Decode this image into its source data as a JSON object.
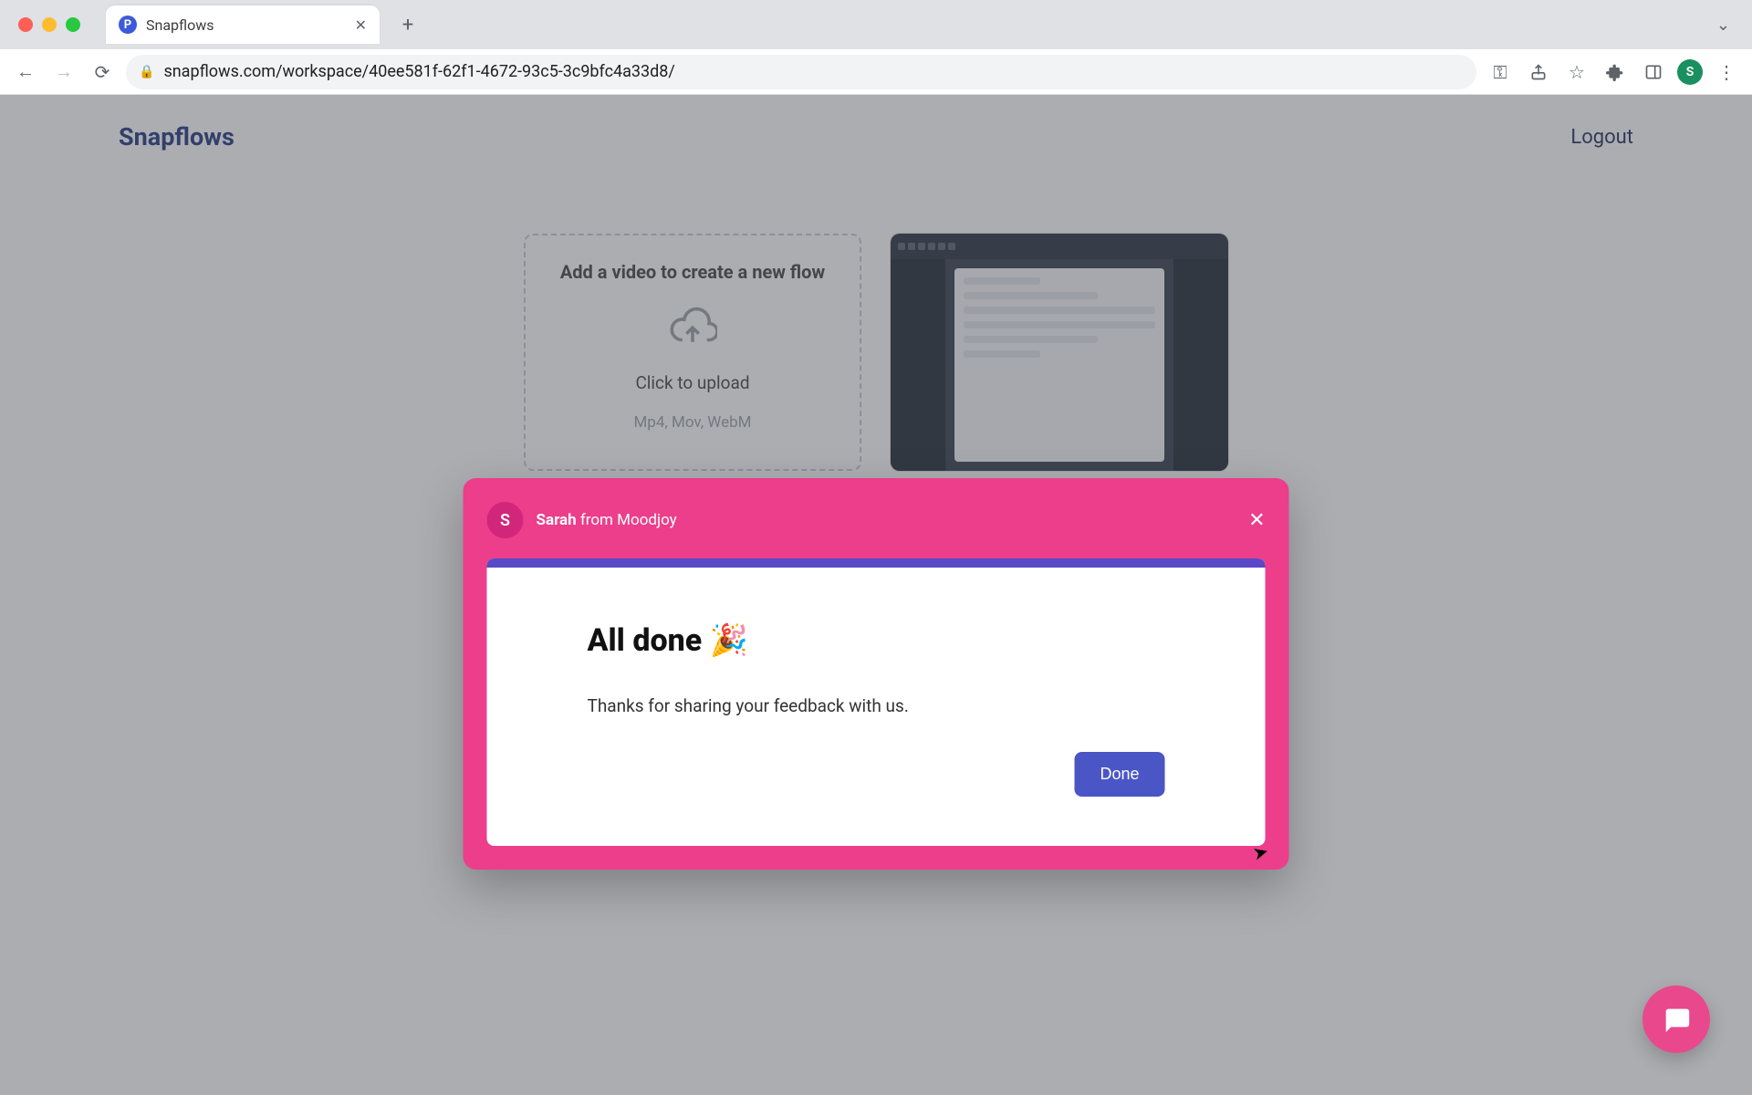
{
  "browser": {
    "tab_title": "Snapflows",
    "favicon_letter": "P",
    "url": "snapflows.com/workspace/40ee581f-62f1-4672-93c5-3c9bfc4a33d8/",
    "profile_initial": "S"
  },
  "header": {
    "logo": "Snapflows",
    "logout": "Logout"
  },
  "workspace": {
    "add_card": {
      "title": "Add a video to create a new flow",
      "click_line": "Click to upload",
      "sub_line": "Mp4, Mov, WebM"
    }
  },
  "modal": {
    "avatar_initial": "S",
    "sender_name": "Sarah",
    "sender_suffix": " from Moodjoy",
    "title": "All done 🎉",
    "body": "Thanks for sharing your feedback with us.",
    "done_label": "Done"
  }
}
